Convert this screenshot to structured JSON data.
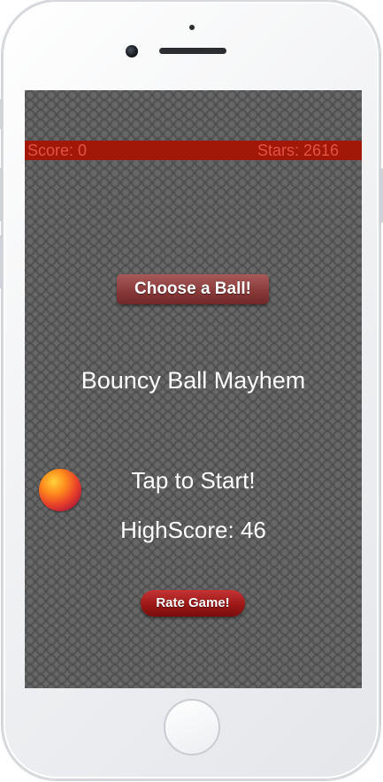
{
  "score_bar": {
    "score": "Score: 0",
    "stars": "Stars: 2616"
  },
  "choose_ball_label": "Choose a Ball!",
  "game_title": "Bouncy Ball Mayhem",
  "tap_to_start": "Tap to Start!",
  "high_score": "HighScore: 46",
  "rate_game_label": "Rate Game!",
  "colors": {
    "score_bar": "#a11808",
    "score_text": "#e3533f",
    "background_pattern": "#5a5a5a",
    "choose_button": "#8a3a3a",
    "rate_button": "#9c1818"
  }
}
